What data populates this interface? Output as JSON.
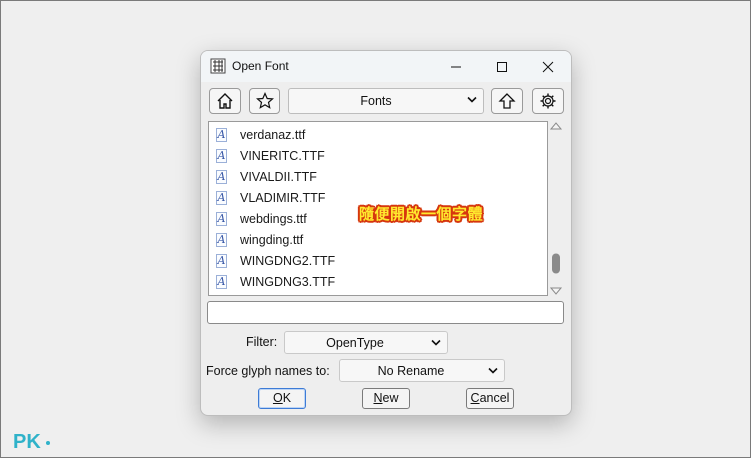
{
  "window": {
    "title": "Open Font"
  },
  "toolbar": {
    "path_value": "Fonts"
  },
  "files": [
    {
      "name": "verdanaz.ttf"
    },
    {
      "name": "VINERITC.TTF"
    },
    {
      "name": "VIVALDII.TTF"
    },
    {
      "name": "VLADIMIR.TTF"
    },
    {
      "name": "webdings.ttf"
    },
    {
      "name": "wingding.ttf"
    },
    {
      "name": "WINGDNG2.TTF"
    },
    {
      "name": "WINGDNG3.TTF"
    }
  ],
  "file_icon_glyph": "A",
  "annotation": "隨便開啟一個字體",
  "filename_input": {
    "value": ""
  },
  "filter": {
    "label": "Filter:",
    "value": "OpenType"
  },
  "glyph_names": {
    "label": "Force glyph names to:",
    "value": "No Rename"
  },
  "buttons": {
    "ok": {
      "key": "O",
      "rest": "K"
    },
    "new": {
      "key": "N",
      "rest": "ew"
    },
    "cancel": {
      "key": "C",
      "rest": "ancel"
    }
  },
  "scrollbar": {
    "position": 0.92
  },
  "watermark": "PK",
  "colors": {
    "accent": "#3d7bd6",
    "annotation_fill": "#ffea2e",
    "annotation_stroke": "#d6360e",
    "watermark": "#2fb2c9"
  },
  "icons": [
    "app-font-icon",
    "minimize-icon",
    "maximize-icon",
    "close-icon",
    "home-icon",
    "star-icon",
    "chevron-down-icon",
    "up-arrow-icon",
    "gear-icon",
    "font-file-icon"
  ]
}
